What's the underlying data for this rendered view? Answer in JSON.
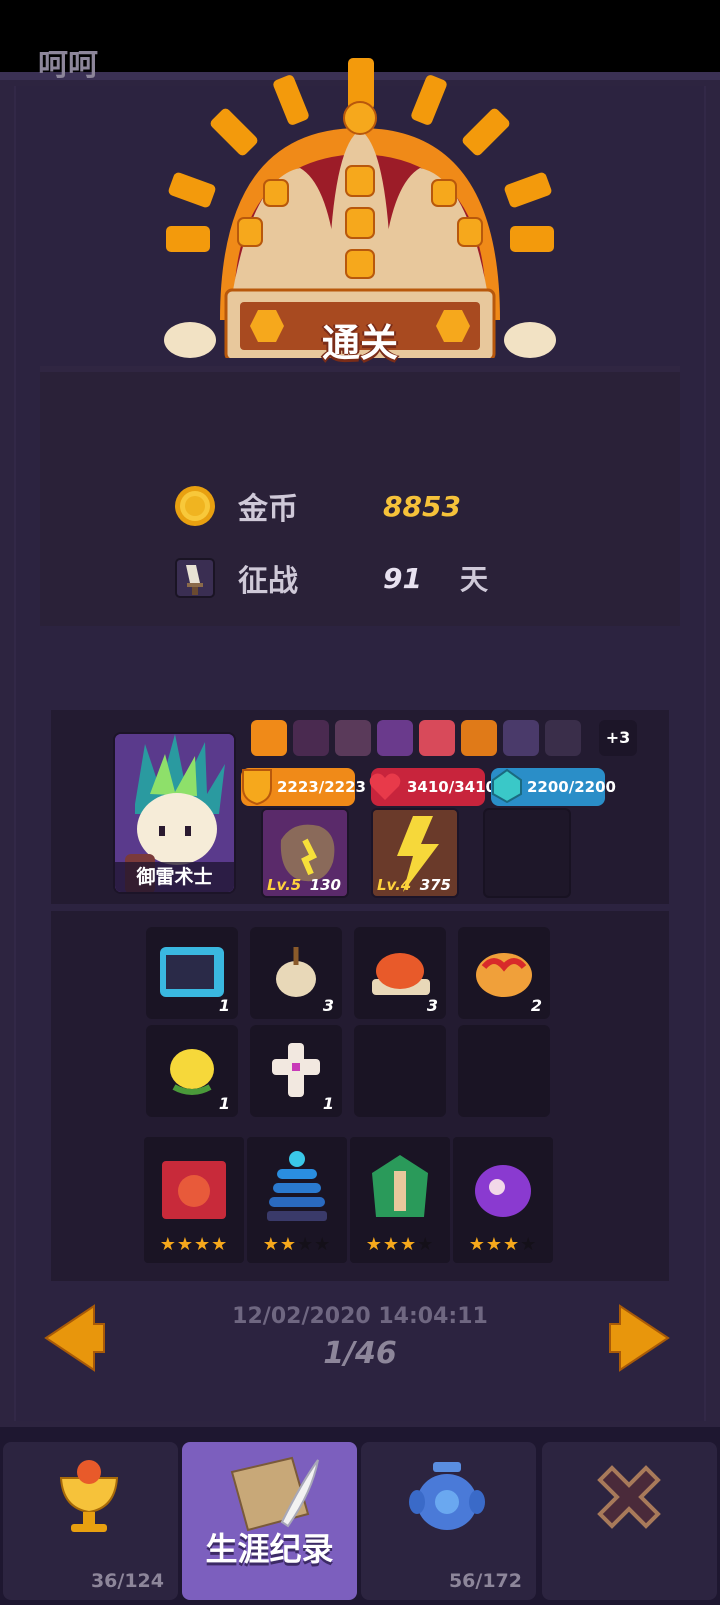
{
  "player": {
    "name": "呵呵"
  },
  "result": {
    "label": "通关"
  },
  "stats": {
    "gold_label": "金币",
    "gold_value": "8853",
    "days_label": "征战",
    "days_value": "91",
    "days_unit": "天"
  },
  "hero": {
    "name": "御雷术士",
    "traits_more": "+3",
    "armor": "2223/2223",
    "health": "3410/3410",
    "mana": "2200/2200",
    "skills": [
      {
        "level": "Lv.5",
        "value": "130"
      },
      {
        "level": "Lv.4",
        "value": "375"
      }
    ]
  },
  "items": [
    {
      "icon": "treasure-chest-icon",
      "count": "1"
    },
    {
      "icon": "onion-icon",
      "count": "3"
    },
    {
      "icon": "roast-turkey-icon",
      "count": "3"
    },
    {
      "icon": "pie-icon",
      "count": "2"
    },
    {
      "icon": "lemon-icon",
      "count": "1"
    },
    {
      "icon": "cross-icon",
      "count": "1"
    }
  ],
  "towers": [
    {
      "icon": "monkey-tower-icon",
      "stars": 4
    },
    {
      "icon": "blue-coil-tower-icon",
      "stars": 2
    },
    {
      "icon": "green-crossbow-tower-icon",
      "stars": 3
    },
    {
      "icon": "purple-blob-tower-icon",
      "stars": 3
    }
  ],
  "record": {
    "datetime": "12/02/2020 14:04:11",
    "page": "1/46"
  },
  "tabs": [
    {
      "icon": "trophy-icon",
      "count": "36/124"
    },
    {
      "icon": "scroll-quill-icon",
      "label": "生涯纪录"
    },
    {
      "icon": "blue-jar-icon",
      "count": "56/172"
    },
    {
      "icon": "close-icon"
    }
  ],
  "colors": {
    "gold": "#f6c23a",
    "armor": "#f08a1c",
    "health": "#c8243c",
    "mana": "#2a8ec8",
    "accent": "#7c5fbe"
  }
}
